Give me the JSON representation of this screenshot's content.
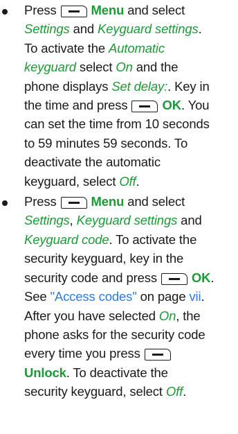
{
  "bullets": [
    {
      "lines": [
        [
          {
            "t": "Press "
          },
          {
            "key": "softkey-icon"
          },
          {
            "t": " "
          },
          {
            "t": "Menu",
            "s": "bold"
          },
          {
            "t": " and select"
          }
        ],
        [
          {
            "t": "Settings",
            "s": "italic"
          },
          {
            "t": " and "
          },
          {
            "t": "Keyguard settings",
            "s": "italic"
          },
          {
            "t": "."
          }
        ],
        [
          {
            "t": "To activate the "
          },
          {
            "t": "Automatic",
            "s": "italic"
          }
        ],
        [
          {
            "t": "keyguard",
            "s": "italic"
          },
          {
            "t": " select "
          },
          {
            "t": "On",
            "s": "italic"
          },
          {
            "t": " and the"
          }
        ],
        [
          {
            "t": "phone displays "
          },
          {
            "t": "Set delay:",
            "s": "italic"
          },
          {
            "t": ". Key in"
          }
        ],
        [
          {
            "t": "the time and press "
          },
          {
            "key": "softkey-icon"
          },
          {
            "t": " "
          },
          {
            "t": "OK",
            "s": "bold"
          },
          {
            "t": ". You"
          }
        ],
        [
          {
            "t": "can set the time from 10 seconds"
          }
        ],
        [
          {
            "t": "to 59 minutes 59 seconds. To"
          }
        ],
        [
          {
            "t": "deactivate the automatic"
          }
        ],
        [
          {
            "t": "keyguard, select "
          },
          {
            "t": "Off",
            "s": "italic"
          },
          {
            "t": "."
          }
        ]
      ]
    },
    {
      "lines": [
        [
          {
            "t": "Press "
          },
          {
            "key": "softkey-icon"
          },
          {
            "t": " "
          },
          {
            "t": "Menu",
            "s": "bold"
          },
          {
            "t": " and select"
          }
        ],
        [
          {
            "t": "Settings",
            "s": "italic"
          },
          {
            "t": ", "
          },
          {
            "t": "Keyguard settings",
            "s": "italic"
          },
          {
            "t": " and"
          }
        ],
        [
          {
            "t": "Keyguard code",
            "s": "italic"
          },
          {
            "t": ". To activate the"
          }
        ],
        [
          {
            "t": "security keyguard, key in the"
          }
        ],
        [
          {
            "t": "security code and press "
          },
          {
            "key": "softkey-icon"
          },
          {
            "t": " "
          },
          {
            "t": "OK",
            "s": "bold"
          },
          {
            "t": "."
          }
        ],
        [
          {
            "t": "See "
          },
          {
            "t": "\"Access codes\"",
            "s": "link"
          },
          {
            "t": " on page "
          },
          {
            "t": "vii",
            "s": "link"
          },
          {
            "t": "."
          }
        ],
        [
          {
            "t": "After you have selected "
          },
          {
            "t": "On",
            "s": "italic"
          },
          {
            "t": ", the"
          }
        ],
        [
          {
            "t": "phone asks for the security code"
          }
        ],
        [
          {
            "t": "every time you press "
          },
          {
            "key": "softkey-icon"
          }
        ],
        [
          {
            "t": "Unlock",
            "s": "bold"
          },
          {
            "t": ". To deactivate the"
          }
        ],
        [
          {
            "t": "security keyguard, select "
          },
          {
            "t": "Off",
            "s": "italic"
          },
          {
            "t": "."
          }
        ]
      ]
    }
  ]
}
